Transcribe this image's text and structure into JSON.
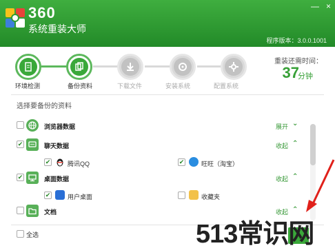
{
  "app": {
    "logo_num": "360",
    "logo_name": "系统重装大师",
    "version": "程序版本：3.0.0.1001",
    "win_buttons": [
      "—",
      "×"
    ]
  },
  "steps": [
    {
      "label": "环境检测",
      "state": "done"
    },
    {
      "label": "备份资料",
      "state": "done"
    },
    {
      "label": "下载文件",
      "state": "todo"
    },
    {
      "label": "安装系统",
      "state": "todo"
    },
    {
      "label": "配置系统",
      "state": "todo"
    }
  ],
  "time": {
    "label": "重装还需时间：",
    "value": "37",
    "unit": "分钟"
  },
  "backup": {
    "section_title": "选择要备份的资料",
    "categories": [
      {
        "name": "浏览器数据",
        "toggle": "展开",
        "checked": false
      },
      {
        "name": "聊天数据",
        "toggle": "收起",
        "checked": true,
        "items": [
          {
            "name": "腾讯QQ",
            "checked": true
          },
          {
            "name": "旺旺（淘宝）",
            "checked": true
          }
        ]
      },
      {
        "name": "桌面数据",
        "toggle": "收起",
        "checked": true,
        "items": [
          {
            "name": "用户桌面",
            "checked": true
          },
          {
            "name": "收藏夹",
            "checked": false
          }
        ]
      },
      {
        "name": "文档",
        "toggle": "收起",
        "checked": false
      }
    ],
    "select_all": "全选"
  },
  "watermark": "513常识网",
  "colors": {
    "brand_green": "#2e9a33",
    "accent": "#37a037",
    "arrow": "#e0201a"
  }
}
